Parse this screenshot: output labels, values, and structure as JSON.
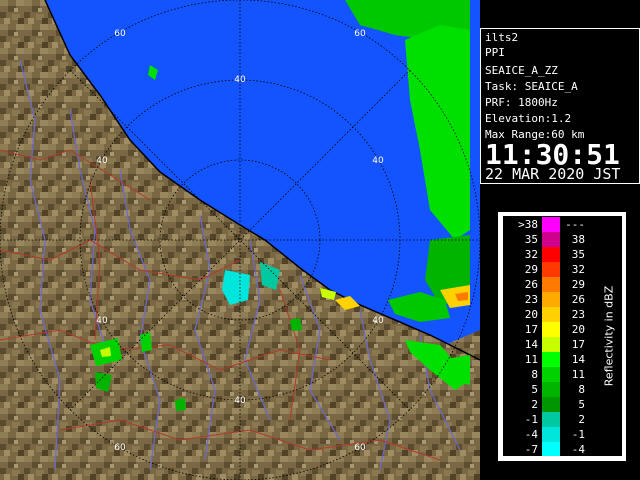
{
  "map": {
    "ring_labels": [
      "60",
      "40",
      "40",
      "40",
      "40",
      "40",
      "60"
    ],
    "colors": {
      "sea": "#1454ff",
      "land_light": "#8c7a52",
      "land_mid": "#6b5a3a",
      "land_dark": "#4a3d25",
      "river": "#6a6ad0",
      "boundary": "#b03a2a",
      "coast": "#000000",
      "ring": "#000000"
    }
  },
  "info": {
    "station": "ilts2",
    "mode": "PPI",
    "product": "SEAICE_A_ZZ",
    "task": "Task: SEAICE_A",
    "prf": "PRF: 1800Hz",
    "elevation": "Elevation:1.2",
    "max_range": "Max Range:60 km",
    "time": "11:30:51",
    "date": "22 MAR 2020 JST"
  },
  "legend": {
    "title": "Reflectivity in dBZ",
    "rows": [
      {
        "left": ">38",
        "right": "---",
        "color": "#ff00ff"
      },
      {
        "left": "35",
        "right": "38",
        "color": "#d0008f"
      },
      {
        "left": "32",
        "right": "35",
        "color": "#ff0000"
      },
      {
        "left": "29",
        "right": "32",
        "color": "#ff3a00"
      },
      {
        "left": "26",
        "right": "29",
        "color": "#ff7a00"
      },
      {
        "left": "23",
        "right": "26",
        "color": "#ffaa00"
      },
      {
        "left": "20",
        "right": "23",
        "color": "#ffd200"
      },
      {
        "left": "17",
        "right": "20",
        "color": "#ffff00"
      },
      {
        "left": "14",
        "right": "17",
        "color": "#c8ff00"
      },
      {
        "left": "11",
        "right": "14",
        "color": "#00ff00"
      },
      {
        "left": "8",
        "right": "11",
        "color": "#00d200"
      },
      {
        "left": "5",
        "right": "8",
        "color": "#00b400"
      },
      {
        "left": "2",
        "right": "5",
        "color": "#009600"
      },
      {
        "left": "-1",
        "right": "2",
        "color": "#00c8a0"
      },
      {
        "left": "-4",
        "right": "-1",
        "color": "#00e6dc"
      },
      {
        "left": "-7",
        "right": "-4",
        "color": "#00ffff"
      }
    ]
  }
}
